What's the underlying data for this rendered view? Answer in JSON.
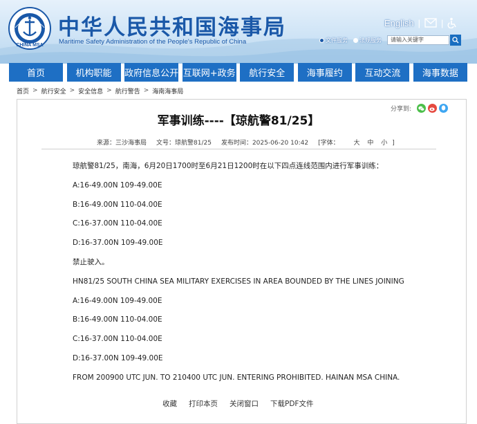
{
  "site": {
    "title": "中华人民共和国海事局",
    "subtitle": "Maritime Safety Administration of the People's Republic of China",
    "logo_text": "CHINA MSA"
  },
  "top_links": {
    "english": "English",
    "separator": "|",
    "mail_icon": "mail-icon",
    "accessibility_icon": "accessibility-icon"
  },
  "search": {
    "options": [
      "文件服务",
      "法规服务"
    ],
    "placeholder": "请输入关键字"
  },
  "nav": {
    "items": [
      "首页",
      "机构职能",
      "政府信息公开",
      "互联网+政务",
      "航行安全",
      "海事履约",
      "互动交流",
      "海事数据"
    ]
  },
  "breadcrumb": {
    "items": [
      "首页",
      "航行安全",
      "安全信息",
      "航行警告",
      "海南海事局"
    ],
    "separator": ">"
  },
  "share": {
    "label": "分享到:",
    "icons": [
      "wechat-icon",
      "weibo-icon",
      "qq-icon"
    ]
  },
  "article": {
    "title": "军事训练----【琼航警81/25】",
    "meta": {
      "source": "来源：三沙海事局",
      "number": "文号：琼航警81/25",
      "published": "发布时间：2025-06-20 10:42",
      "font_label": "[字体：",
      "font_large": "大",
      "font_medium": "中",
      "font_small": "小",
      "font_close": "]"
    },
    "paragraphs": [
      "琼航警81/25，南海，6月20日1700时至6月21日1200时在以下四点连线范围内进行军事训练：",
      "A:16-49.00N 109-49.00E",
      "B:16-49.00N 110-04.00E",
      "C:16-37.00N 110-04.00E",
      "D:16-37.00N 109-49.00E",
      "禁止驶入。",
      "HN81/25 SOUTH CHINA SEA MILITARY EXERCISES IN AREA BOUNDED BY THE LINES JOINING",
      "A:16-49.00N 109-49.00E",
      "B:16-49.00N 110-04.00E",
      "C:16-37.00N 110-04.00E",
      "D:16-37.00N 109-49.00E",
      "FROM 200900 UTC JUN. TO 210400 UTC JUN. ENTERING PROHIBITED. HAINAN MSA CHINA."
    ]
  },
  "footer": {
    "links": [
      "收藏",
      "打印本页",
      "关闭窗口",
      "下载PDF文件"
    ]
  },
  "colors": {
    "brand_blue": "#1a58a8",
    "nav_blue": "#1e6fc4",
    "wechat_green": "#4cbf4a",
    "weibo_red": "#e5493f",
    "qq_blue": "#3ea6f2"
  }
}
